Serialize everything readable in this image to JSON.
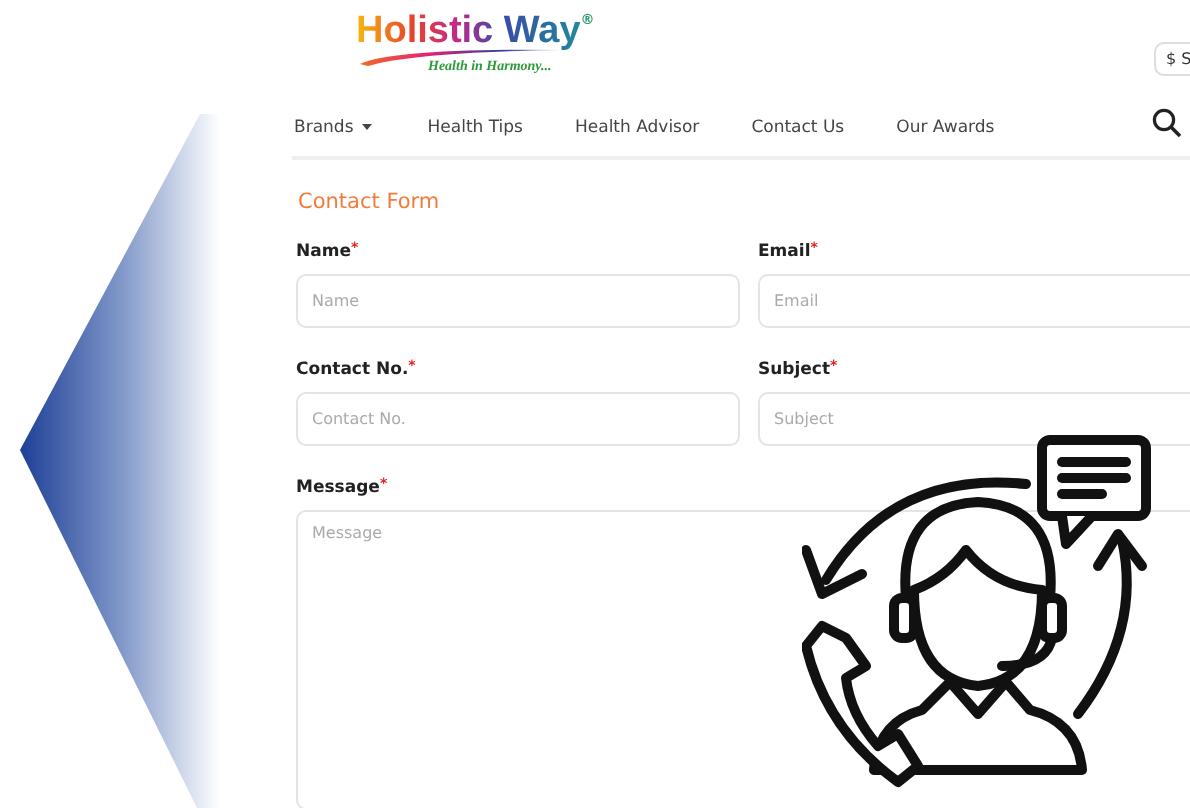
{
  "logo": {
    "name": "Holistic Way",
    "registered": "®",
    "tagline": "Health in Harmony..."
  },
  "currency": "$ S",
  "nav": [
    {
      "label": "Brands",
      "dropdown": true
    },
    {
      "label": "Health Tips",
      "dropdown": false
    },
    {
      "label": "Health Advisor",
      "dropdown": false
    },
    {
      "label": "Contact Us",
      "dropdown": false
    },
    {
      "label": "Our Awards",
      "dropdown": false
    }
  ],
  "form": {
    "title": "Contact Form",
    "fields": [
      {
        "label": "Name",
        "mark": "*",
        "placeholder": "Name",
        "kind": "input"
      },
      {
        "label": "Email",
        "mark": "*",
        "placeholder": "Email",
        "kind": "input"
      },
      {
        "label": "Contact No.",
        "mark": "*",
        "placeholder": "Contact No.",
        "kind": "input"
      },
      {
        "label": "Subject",
        "mark": "*",
        "placeholder": "Subject",
        "kind": "input"
      },
      {
        "label": "Message",
        "mark": "*",
        "placeholder": "Message",
        "kind": "textarea"
      }
    ]
  }
}
